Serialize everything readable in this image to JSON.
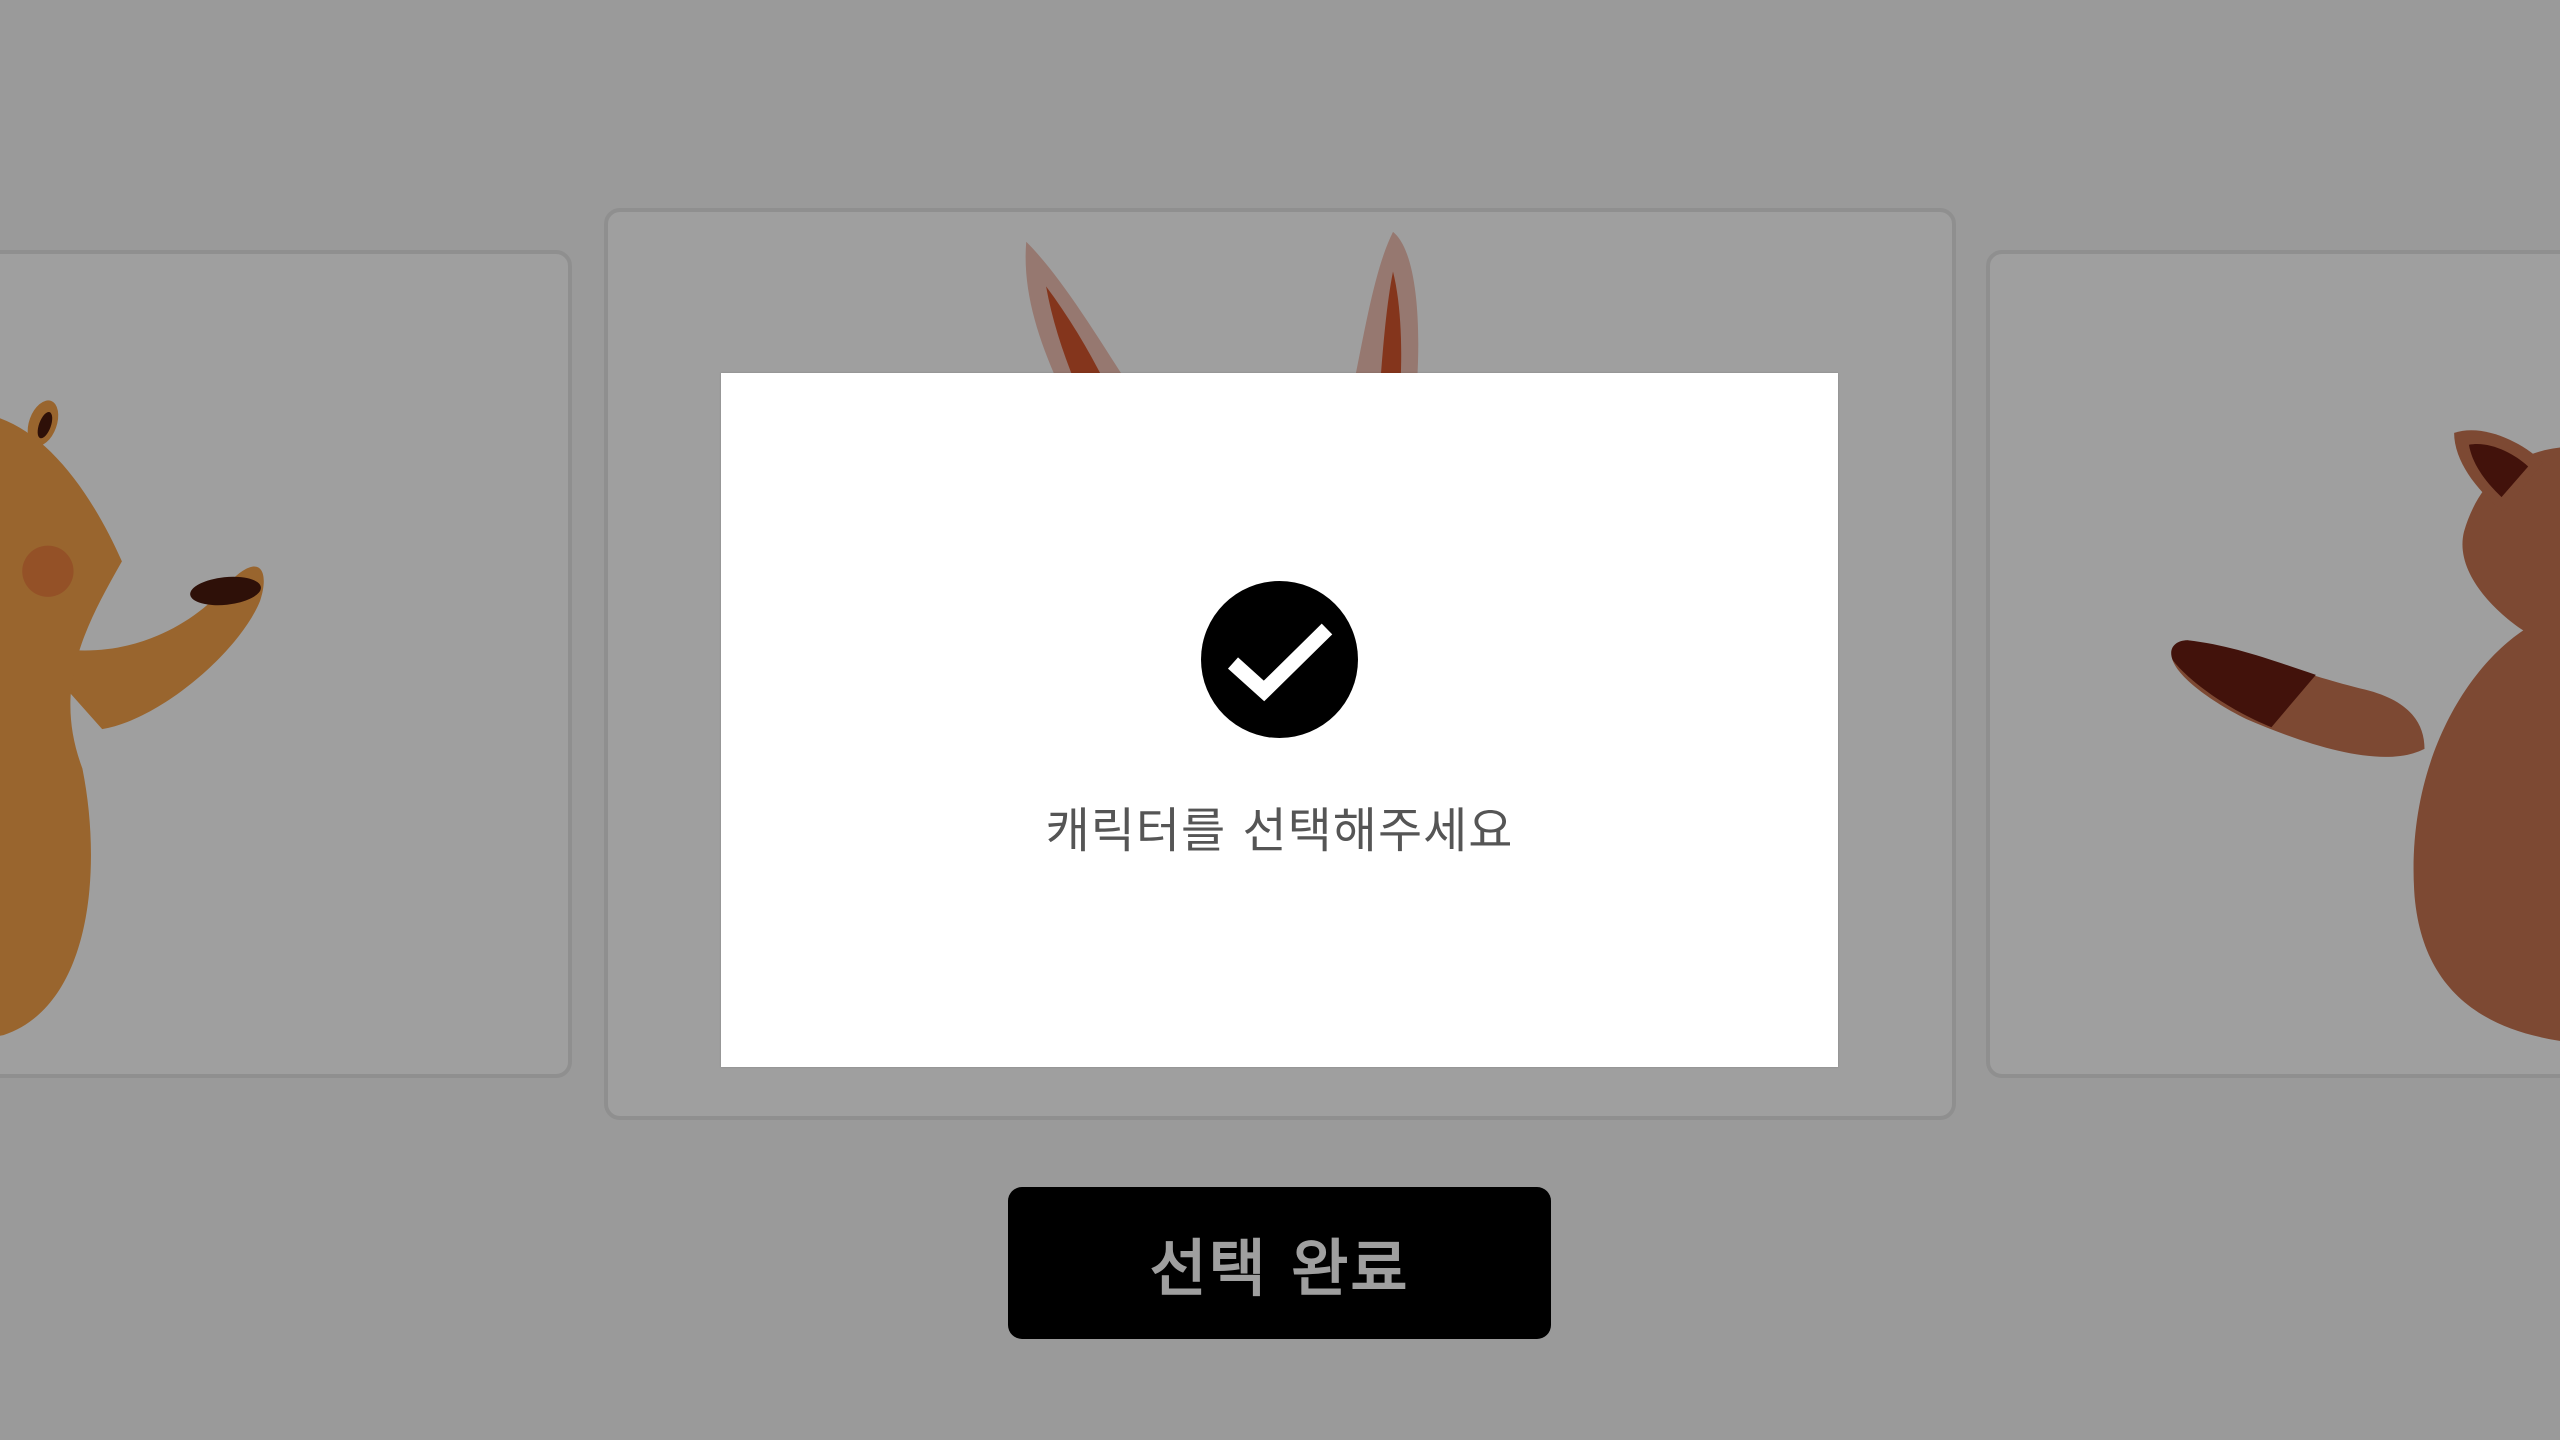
{
  "characters": [
    {
      "icon": "bear-character-icon",
      "color": "#f6a24a"
    },
    {
      "icon": "rabbit-character-icon",
      "color": "#f0c1b4"
    },
    {
      "icon": "raccoon-character-icon",
      "color": "#c97552"
    }
  ],
  "done_button": {
    "label": "선택 완료",
    "color": "#000000"
  },
  "modal": {
    "icon": "check-circle-icon",
    "message": "캐릭터를 선택해주세요"
  }
}
